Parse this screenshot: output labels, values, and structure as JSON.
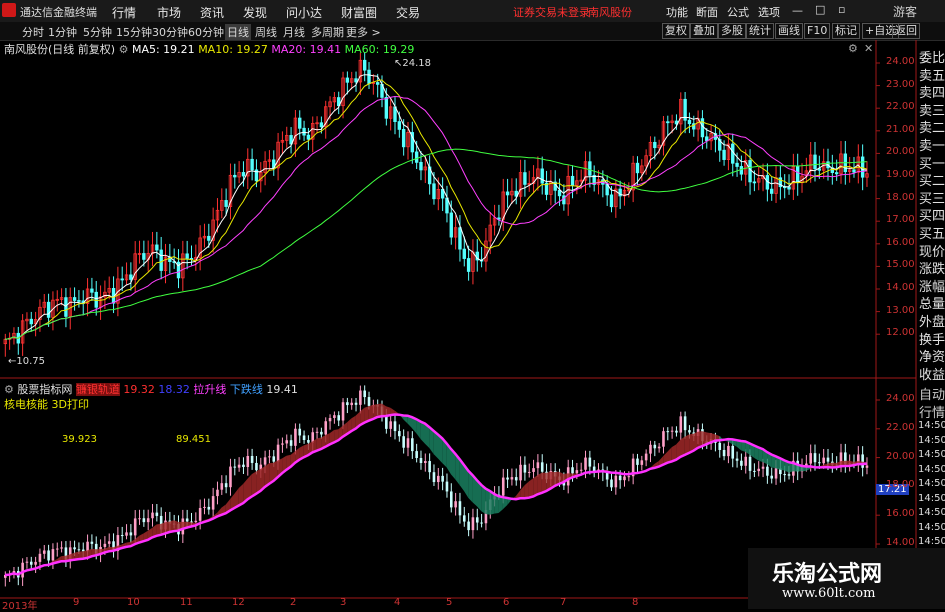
{
  "app": {
    "title": "通达信金融终端"
  },
  "menu": [
    "行情",
    "市场",
    "资讯",
    "发现",
    "问小达",
    "财富圈",
    "交易"
  ],
  "warning": "证券交易未登录",
  "stock_name": "南风股份",
  "right_menu": [
    "功能",
    "断面",
    "公式",
    "选项"
  ],
  "window_button": "游客",
  "toolbar": {
    "periods": [
      "分时",
      "1分钟",
      "5分钟",
      "15分钟",
      "30分钟",
      "60分钟",
      "日线",
      "周线",
      "月线",
      "多周期",
      "更多 >"
    ],
    "active_period": "日线",
    "right": [
      "复权",
      "叠加",
      "多股",
      "统计",
      "画线",
      "F10",
      "标记",
      "+自选",
      "返回"
    ]
  },
  "main_chart": {
    "title": "南风股份(日线 前复权)",
    "ma": [
      {
        "label": "MA5: 19.21",
        "color": "#ffffff"
      },
      {
        "label": "MA10: 19.27",
        "color": "#e8e800"
      },
      {
        "label": "MA20: 19.41",
        "color": "#ff40ff"
      },
      {
        "label": "MA60: 19.29",
        "color": "#40ff40"
      }
    ],
    "high_label": "24.18",
    "low_label": "10.75",
    "y_ticks": [
      "24.00",
      "23.00",
      "22.00",
      "21.00",
      "20.00",
      "19.00",
      "18.00",
      "17.00",
      "16.00",
      "15.00",
      "14.00",
      "13.00",
      "12.00"
    ]
  },
  "side_labels": [
    "委比",
    "卖五",
    "卖四",
    "卖三",
    "卖二",
    "卖一",
    "买一",
    "买二",
    "买三",
    "买四",
    "买五",
    "现价",
    "涨跌",
    "涨幅",
    "总量",
    "外盘",
    "换手",
    "净资",
    "收益",
    "自动",
    "行情"
  ],
  "sub_chart": {
    "title": "股票指标网",
    "items": [
      {
        "label": "镰银轨道",
        "color": "#ff3030",
        "bg": "#7a1010"
      },
      {
        "label": "19.32",
        "color": "#ff3030"
      },
      {
        "label": "18.32",
        "color": "#4040ff"
      },
      {
        "label": "拉升线",
        "color": "#ff40ff"
      },
      {
        "label": "下跌线",
        "color": "#40a0ff"
      },
      {
        "label": "19.41",
        "color": "#e0e0e0"
      }
    ],
    "subtitle": "核电核能  3D打印",
    "value1": "39.923",
    "value2": "89.451",
    "y_ticks": [
      "24.00",
      "22.00",
      "20.00",
      "18.00",
      "16.00",
      "14.00"
    ],
    "right_ticks": [
      "14:50",
      "14:50",
      "14:50",
      "14:50",
      "14:50",
      "14:50",
      "14:50",
      "14:50",
      "14:50",
      "14:50"
    ],
    "price_tag": "17.21"
  },
  "dates": [
    "2013年",
    "9",
    "10",
    "11",
    "12",
    "2",
    "3",
    "4",
    "5",
    "6",
    "7",
    "8"
  ],
  "watermark": {
    "title": "乐淘公式网",
    "url": "www.60lt.com"
  },
  "chart_data": {
    "type": "candlestick",
    "title": "南风股份(日线 前复权)",
    "ylim": [
      10.5,
      24.5
    ],
    "high": 24.18,
    "low": 10.75,
    "close_path": [
      11.2,
      11.8,
      12.4,
      12.9,
      13.2,
      13.0,
      13.5,
      13.3,
      13.6,
      14.2,
      15.2,
      15.6,
      15.0,
      14.8,
      15.2,
      16.0,
      17.2,
      18.6,
      19.4,
      19.0,
      19.6,
      20.6,
      21.2,
      20.8,
      21.8,
      22.6,
      23.4,
      23.9,
      23.0,
      21.8,
      20.8,
      19.8,
      18.6,
      17.8,
      16.0,
      14.8,
      15.4,
      17.2,
      18.2,
      18.6,
      19.0,
      18.4,
      18.0,
      18.8,
      19.2,
      18.4,
      17.8,
      18.6,
      19.6,
      20.4,
      21.4,
      21.9,
      21.2,
      20.8,
      20.2,
      19.6,
      19.0,
      18.7,
      18.4,
      18.6,
      19.0,
      19.6,
      19.2,
      19.4,
      19.3,
      19.2
    ]
  }
}
